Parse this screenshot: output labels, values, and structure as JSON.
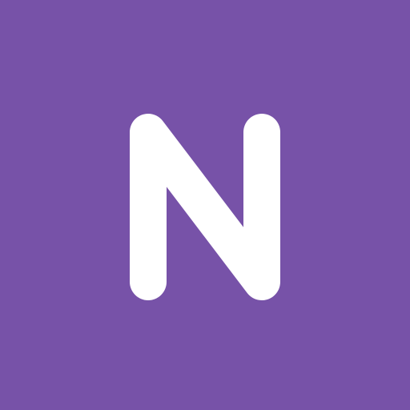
{
  "app_icon": {
    "letter": "N",
    "background_color": "#7752a8",
    "foreground_color": "#ffffff",
    "icon_name": "n-letter-icon"
  }
}
